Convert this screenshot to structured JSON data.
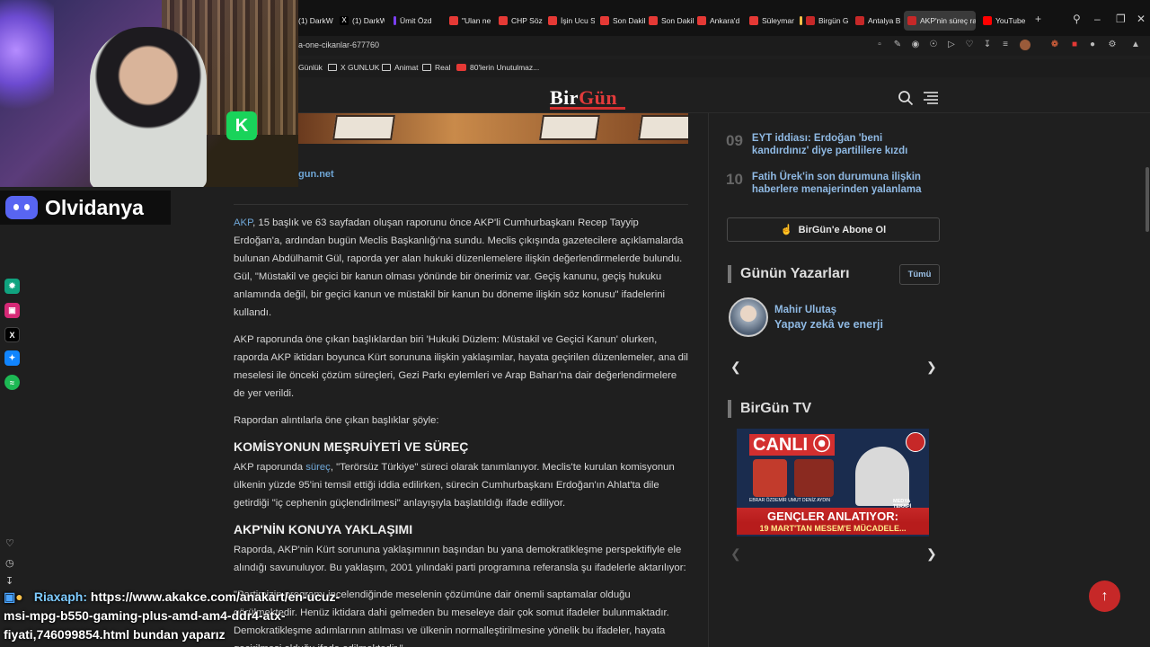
{
  "browser": {
    "tabs": [
      {
        "label": "(1) DarkW",
        "color": "#666"
      },
      {
        "label": "(1) DarkW",
        "color": "#666"
      },
      {
        "label": "Ümit Özd",
        "color": "#7b3ff2"
      },
      {
        "label": "\"Ulan ne",
        "color": "#e53935"
      },
      {
        "label": "CHP Söz",
        "color": "#e53935"
      },
      {
        "label": "İşin Ucu S",
        "color": "#e53935"
      },
      {
        "label": "Son Dakik",
        "color": "#e53935"
      },
      {
        "label": "Son Dakik",
        "color": "#e53935"
      },
      {
        "label": "Ankara'd",
        "color": "#e53935"
      },
      {
        "label": "Süleyman",
        "color": "#e53935"
      },
      {
        "label": "Birgün G",
        "color": "#c62828"
      },
      {
        "label": "Antalya B",
        "color": "#c62828"
      },
      {
        "label": "AKP'nin süreç rap",
        "color": "#c62828"
      },
      {
        "label": "YouTube",
        "color": "#ff0000"
      }
    ],
    "url": "a-one-cikanlar-677760",
    "bookmarks": [
      "Günlük",
      "X GUNLUK",
      "Animat",
      "Real",
      "80'lerin Unutulmaz..."
    ]
  },
  "site": {
    "logo_part1": "Bir",
    "logo_part2": "Gün",
    "source_link": "gun.net"
  },
  "article": {
    "p1_link": "AKP",
    "p1": ", 15 başlık ve 63 sayfadan oluşan raporunu önce AKP'li Cumhurbaşkanı Recep Tayyip Erdoğan'a, ardından bugün Meclis Başkanlığı'na sundu. Meclis çıkışında gazetecilere açıklamalarda bulunan Abdülhamit Gül, raporda yer alan hukuki düzenlemelere ilişkin değerlendirmelerde bulundu. Gül, \"Müstakil ve geçici bir kanun olması yönünde bir önerimiz var. Geçiş kanunu, geçiş hukuku anlamında değil, bir geçici kanun ve müstakil bir kanun bu döneme ilişkin söz konusu\" ifadelerini kullandı.",
    "p2": "AKP raporunda öne çıkan başlıklardan biri 'Hukuki Düzlem: Müstakil ve Geçici Kanun' olurken, raporda AKP iktidarı boyunca Kürt sorununa ilişkin yaklaşımlar, hayata geçirilen düzenlemeler, ana dil meselesi ile önceki çözüm süreçleri, Gezi Parkı eylemleri ve Arap Baharı'na dair değerlendirmelere de yer verildi.",
    "p3": "Rapordan alıntılarla öne çıkan başlıklar şöyle:",
    "h1": "KOMİSYONUN MEŞRUİYETİ VE SÜREÇ",
    "p4_a": "AKP raporunda ",
    "p4_link": "süreç",
    "p4_b": ", \"Terörsüz Türkiye\" süreci olarak tanımlanıyor. Meclis'te kurulan komisyonun ülkenin yüzde 95'ini temsil ettiği iddia edilirken, sürecin Cumhurbaşkanı Erdoğan'ın Ahlat'ta dile getirdiği \"iç cephenin güçlendirilmesi\" anlayışıyla başlatıldığı ifade ediliyor.",
    "h2": "AKP'NİN KONUYA YAKLAŞIMI",
    "p5": "Raporda, AKP'nin Kürt sorununa yaklaşımının başından bu yana demokratikleşme perspektifiyle ele alındığı savunuluyor. Bu yaklaşım, 2001 yılındaki parti programına referansla şu ifadelerle aktarılıyor:",
    "p6": "\"Partimizin programı incelendiğinde meselenin çözümüne dair önemli saptamalar olduğu görülmektedir. Henüz iktidara dahi gelmeden bu meseleye dair çok somut ifadeler bulunmaktadır. Demokratikleşme adımlarının atılması ve ülkenin normalleştirilmesine yönelik bu ifadeler, hayata geçirilmesi olduğu ifade edilmektedir.\""
  },
  "sidebar": {
    "popular": [
      {
        "num": "09",
        "title": "EYT iddiası: Erdoğan 'beni kandırdınız' diye partililere kızdı"
      },
      {
        "num": "10",
        "title": "Fatih Ürek'in son durumuna ilişkin haberlere menajerinden yalanlama"
      }
    ],
    "subscribe": "BirGün'e Abone Ol",
    "writers_title": "Günün Yazarları",
    "all_label": "Tümü",
    "author_name": "Mahir Ulutaş",
    "author_article": "Yapay zekâ ve enerji",
    "tv_title": "BirGün TV",
    "tv_live": "CANLI",
    "tv_headline": "GENÇLER ANLATIYOR:",
    "tv_sub": "19 MART'TAN MESEM'E MÜCADELE...",
    "tv_persons": [
      "EBRAR ÖZDEMİR",
      "UMUT DENİZ AYDIN"
    ],
    "tv_brand": "MEDYA TERAPİ"
  },
  "overlay": {
    "discord_name": "Olvidanya",
    "chat_user": "Riaxaph:",
    "chat_message": "https://www.akakce.com/anakart/en-ucuz-msi-mpg-b550-gaming-plus-amd-am4-ddr4-atx-fiyati,746099854.html bundan yaparız",
    "socials": [
      {
        "icon": "chatgpt-icon",
        "color": "#10a37f"
      },
      {
        "icon": "instagram-icon",
        "color": "#d62976"
      },
      {
        "icon": "x-icon",
        "color": "#000000"
      },
      {
        "icon": "bluesky-icon",
        "color": "#1185fe"
      },
      {
        "icon": "spotify-icon",
        "color": "#1db954"
      }
    ]
  },
  "colors": {
    "accent": "#d32f2f",
    "link": "#6fa6d6",
    "sidebar_link": "#8fb9e3"
  }
}
